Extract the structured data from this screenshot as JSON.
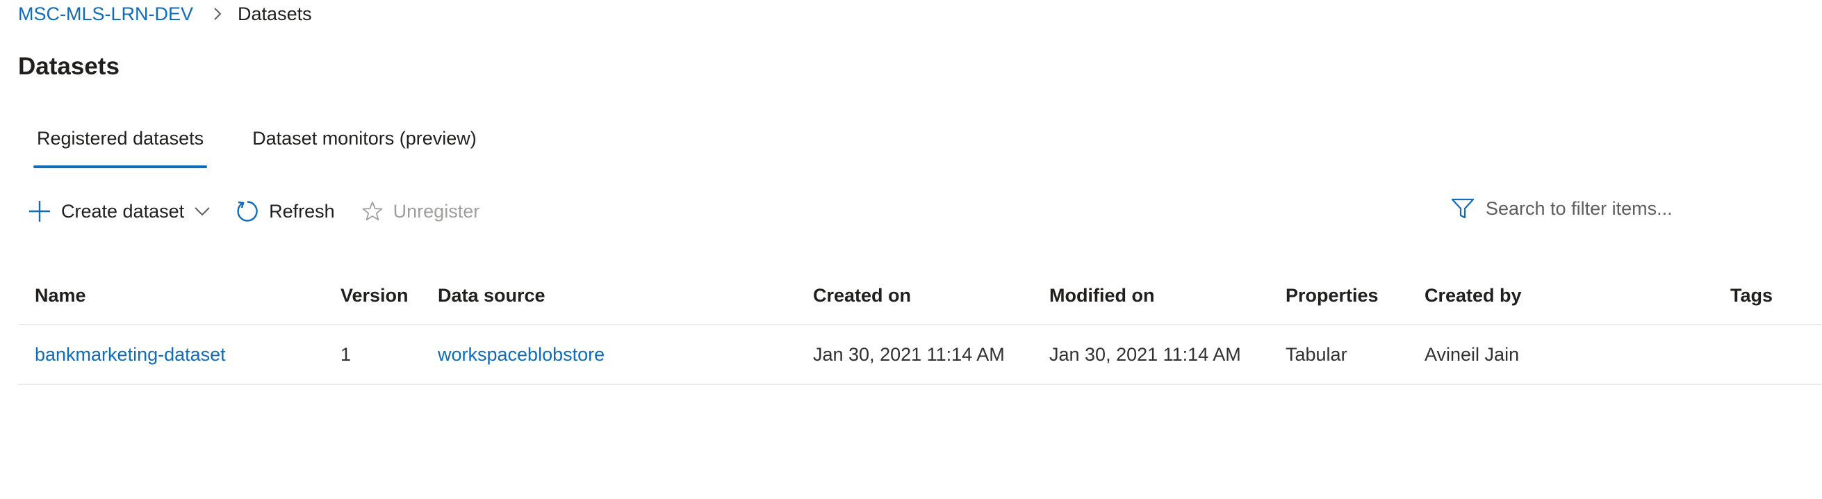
{
  "breadcrumb": {
    "workspace": "MSC-MLS-LRN-DEV",
    "current": "Datasets"
  },
  "page": {
    "title": "Datasets"
  },
  "tabs": [
    {
      "label": "Registered datasets",
      "active": true
    },
    {
      "label": "Dataset monitors (preview)",
      "active": false
    }
  ],
  "toolbar": {
    "create_label": "Create dataset",
    "refresh_label": "Refresh",
    "unregister_label": "Unregister"
  },
  "search": {
    "placeholder": "Search to filter items..."
  },
  "table": {
    "columns": [
      "Name",
      "Version",
      "Data source",
      "Created on",
      "Modified on",
      "Properties",
      "Created by",
      "Tags"
    ],
    "rows": [
      {
        "name": "bankmarketing-dataset",
        "version": "1",
        "data_source": "workspaceblobstore",
        "created_on": "Jan 30, 2021 11:14 AM",
        "modified_on": "Jan 30, 2021 11:14 AM",
        "properties": "Tabular",
        "created_by": "Avineil Jain",
        "tags": ""
      }
    ]
  },
  "colors": {
    "accent": "#0f6cbd",
    "text": "#201f1e",
    "disabled": "#a19f9d",
    "divider": "#edebe9"
  },
  "icons": {
    "breadcrumb_separator": "chevron-right-icon",
    "create": "plus-icon",
    "create_menu": "chevron-down-icon",
    "refresh": "refresh-icon",
    "unregister": "star-icon",
    "search": "filter-icon"
  }
}
